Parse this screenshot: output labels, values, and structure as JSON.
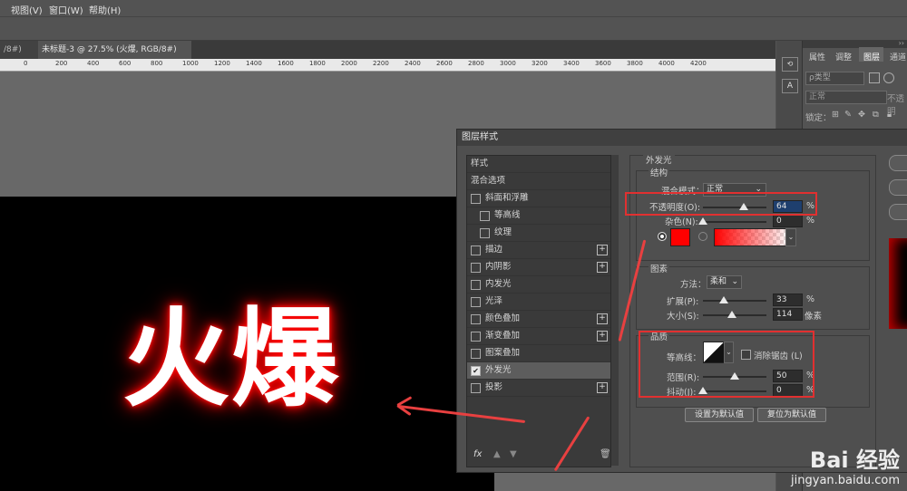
{
  "menubar": {
    "items": [
      "视图(V)",
      "窗口(W)",
      "帮助(H)"
    ]
  },
  "tabs": [
    {
      "label": "/8#) *",
      "close": "×"
    },
    {
      "label": "未标题-3 @ 27.5% (火爆, RGB/8#) *",
      "close": "×"
    }
  ],
  "ruler": {
    "labels": [
      "0",
      "200",
      "400",
      "600",
      "800",
      "1000",
      "1200",
      "1400",
      "1600",
      "1800",
      "2000",
      "2200",
      "2400",
      "2600",
      "2800",
      "3000",
      "3200",
      "3400",
      "3600",
      "3800",
      "4000",
      "4200"
    ]
  },
  "canvas": {
    "text": "火爆",
    "glow_color": "#ff0000"
  },
  "right_panel": {
    "tabs": [
      "属性",
      "调整",
      "图层",
      "通道"
    ],
    "kind_filter": "ρ类型",
    "blend": "正常",
    "opacity_label": "不透明",
    "lock_label": "锁定："
  },
  "dialog": {
    "title": "图层样式",
    "style_list": [
      {
        "label": "样式",
        "checkbox": false,
        "plus": false,
        "indent": false,
        "checked": false
      },
      {
        "label": "混合选项",
        "checkbox": false,
        "plus": false,
        "indent": false,
        "checked": false
      },
      {
        "label": "斜面和浮雕",
        "checkbox": true,
        "plus": false,
        "indent": false,
        "checked": false
      },
      {
        "label": "等高线",
        "checkbox": true,
        "plus": false,
        "indent": true,
        "checked": false
      },
      {
        "label": "纹理",
        "checkbox": true,
        "plus": false,
        "indent": true,
        "checked": false
      },
      {
        "label": "描边",
        "checkbox": true,
        "plus": true,
        "indent": false,
        "checked": false
      },
      {
        "label": "内阴影",
        "checkbox": true,
        "plus": true,
        "indent": false,
        "checked": false
      },
      {
        "label": "内发光",
        "checkbox": true,
        "plus": false,
        "indent": false,
        "checked": false
      },
      {
        "label": "光泽",
        "checkbox": true,
        "plus": false,
        "indent": false,
        "checked": false
      },
      {
        "label": "颜色叠加",
        "checkbox": true,
        "plus": true,
        "indent": false,
        "checked": false
      },
      {
        "label": "渐变叠加",
        "checkbox": true,
        "plus": true,
        "indent": false,
        "checked": false
      },
      {
        "label": "图案叠加",
        "checkbox": true,
        "plus": false,
        "indent": false,
        "checked": false
      },
      {
        "label": "外发光",
        "checkbox": true,
        "plus": false,
        "indent": false,
        "checked": true,
        "selected": true
      },
      {
        "label": "投影",
        "checkbox": true,
        "plus": true,
        "indent": false,
        "checked": false
      }
    ],
    "fx_label": "fx",
    "outer_glow": {
      "title": "外发光",
      "structure": {
        "title": "结构",
        "blend_mode_label": "混合模式：",
        "blend_mode": "正常",
        "opacity_label": "不透明度(O):",
        "opacity": "64",
        "opacity_fraction": 0.64,
        "noise_label": "杂色(N):",
        "noise": "0",
        "noise_fraction": 0,
        "unit": "%",
        "color": "#ff0000"
      },
      "elements": {
        "title": "图素",
        "method_label": "方法：",
        "method": "柔和",
        "spread_label": "扩展(P):",
        "spread": "33",
        "spread_fraction": 0.33,
        "size_label": "大小(S):",
        "size": "114",
        "size_fraction": 0.46,
        "size_unit": "像素"
      },
      "quality": {
        "title": "品质",
        "contour_label": "等高线：",
        "antialias_label": "消除锯齿 (L)",
        "range_label": "范围(R):",
        "range": "50",
        "range_fraction": 0.5,
        "jitter_label": "抖动(J):",
        "jitter": "0",
        "jitter_fraction": 0
      },
      "buttons": {
        "set_default": "设置为默认值",
        "reset_default": "复位为默认值"
      }
    }
  },
  "watermark": {
    "brand": "Bai 经验",
    "url": "jingyan.baidu.com"
  },
  "colors": {
    "annotation": "#e13030"
  }
}
